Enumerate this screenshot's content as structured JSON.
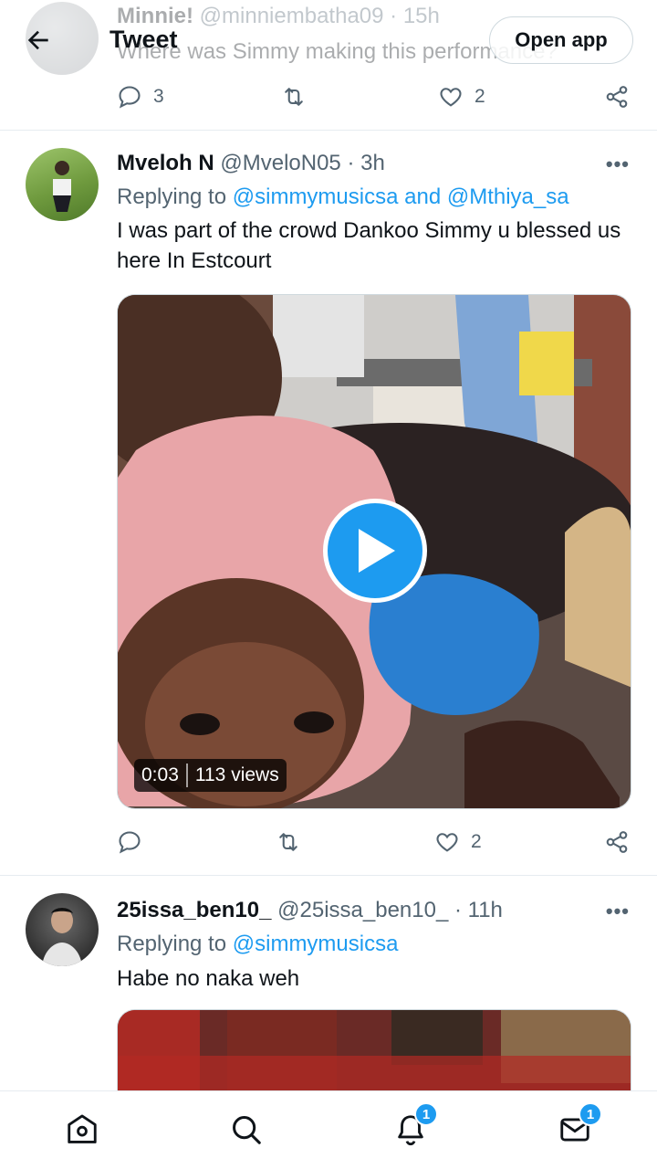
{
  "header": {
    "title": "Tweet",
    "open_app_label": "Open app"
  },
  "tweets": [
    {
      "display_name": "Minnie!",
      "handle": "@minniembatha09",
      "time": "· 15h",
      "text": "Where was Simmy making this performance?",
      "replies": "3",
      "retweets": "",
      "likes": "2"
    },
    {
      "display_name": "Mveloh N",
      "handle": "@MveloN05",
      "time": "· 3h",
      "replying_prefix": "Replying to",
      "replying_to_1": "@simmymusicsa",
      "replying_and": "and",
      "replying_to_2": "@Mthiya_sa",
      "text": "I was part of the crowd Dankoo Simmy u blessed us here In Estcourt",
      "video_time": "0:03",
      "video_views": "113 views",
      "replies": "",
      "retweets": "",
      "likes": "2",
      "more": "•••"
    },
    {
      "display_name": "25issa_ben10_",
      "handle": "@25issa_ben10_",
      "time": "· 11h",
      "replying_prefix": "Replying to",
      "replying_to_1": "@simmymusicsa",
      "text": "Habe no naka weh",
      "more": "•••"
    }
  ],
  "nav": {
    "notifications_badge": "1",
    "messages_badge": "1"
  },
  "colors": {
    "accent": "#1d9bf0",
    "muted": "#536471",
    "text": "#0f1419"
  }
}
